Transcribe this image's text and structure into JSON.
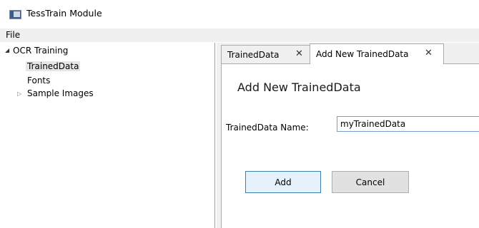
{
  "window": {
    "title": "TessTrain Module",
    "icon": "app-window-icon"
  },
  "menu": {
    "file": "File"
  },
  "tree": {
    "root": {
      "label": "OCR Training",
      "expanded": true
    },
    "children": [
      {
        "label": "TrainedData",
        "selected": true
      },
      {
        "label": "Fonts"
      },
      {
        "label": "Sample Images",
        "expandable": true
      }
    ]
  },
  "tabs": [
    {
      "label": "TrainedData",
      "close": "✕"
    },
    {
      "label": "Add New TrainedData",
      "close": "✕",
      "active": true
    }
  ],
  "form": {
    "heading": "Add New TrainedData",
    "name_label": "TrainedData Name:",
    "name_value": "myTrainedData",
    "add_label": "Add",
    "cancel_label": "Cancel"
  },
  "colors": {
    "accent_border": "#3c7fb1",
    "accent_bg": "#e5f1fb",
    "input_border": "#7a9ccf"
  }
}
